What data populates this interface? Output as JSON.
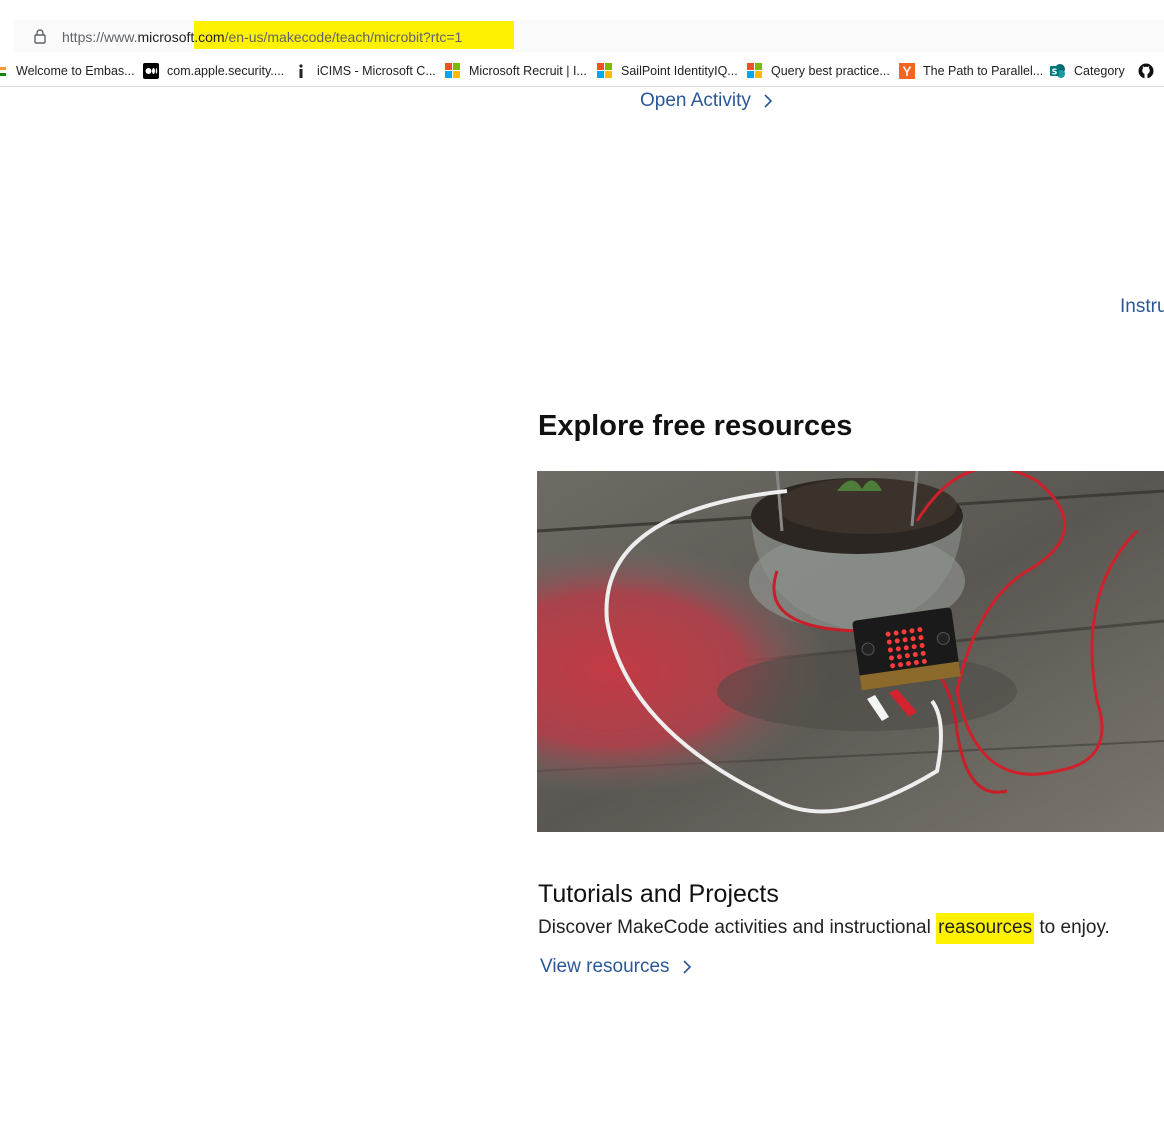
{
  "browser": {
    "url_prefix": "https://www.",
    "url_host": "microsoft.com",
    "url_path": "/en-us/makecode/teach/microbit?rtc=1",
    "highlight_color": "#fff200",
    "bookmarks": [
      {
        "label": "Welcome to Embas...",
        "icon": "flag-icon"
      },
      {
        "label": "com.apple.security....",
        "icon": "medium-icon"
      },
      {
        "label": "iCIMS - Microsoft C...",
        "icon": "info-icon"
      },
      {
        "label": "Microsoft Recruit | I...",
        "icon": "microsoft-logo-icon"
      },
      {
        "label": "SailPoint IdentityIQ...",
        "icon": "microsoft-logo-icon"
      },
      {
        "label": "Query best practice...",
        "icon": "microsoft-logo-icon"
      },
      {
        "label": "The Path to Parallel...",
        "icon": "ycombinator-icon"
      },
      {
        "label": "Category",
        "icon": "sharepoint-icon"
      },
      {
        "label": "",
        "icon": "github-icon"
      }
    ]
  },
  "page": {
    "open_activity_label": "Open Activity",
    "instru_label": "Instru",
    "section_title": "Explore free resources",
    "hero_image_alt": "micro:bit soil moisture sensor project",
    "card": {
      "title": "Tutorials and Projects",
      "desc_before": "Discover MakeCode activities and instructional",
      "desc_highlight": "reasources",
      "desc_after": "to enjoy.",
      "link_label": "View resources"
    },
    "link_color": "#2b5797"
  }
}
